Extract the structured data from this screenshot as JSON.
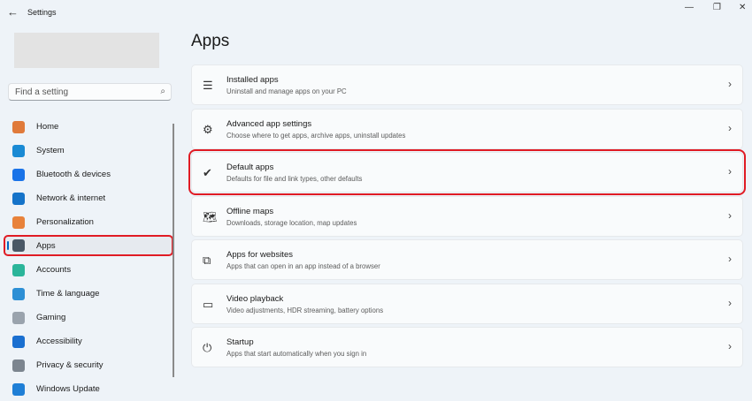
{
  "window": {
    "title": "Settings",
    "back": "←",
    "minimize": "—",
    "maximize": "❐",
    "close": "✕"
  },
  "search": {
    "placeholder": "Find a setting",
    "icon": "⌕"
  },
  "sidebar": {
    "items": [
      {
        "label": "Home",
        "color": "#e07a3a"
      },
      {
        "label": "System",
        "color": "#1a8ad4"
      },
      {
        "label": "Bluetooth & devices",
        "color": "#1a73e8"
      },
      {
        "label": "Network & internet",
        "color": "#1573c9"
      },
      {
        "label": "Personalization",
        "color": "#e8823a"
      },
      {
        "label": "Apps",
        "color": "#4a5866",
        "selected": true
      },
      {
        "label": "Accounts",
        "color": "#2bb59a"
      },
      {
        "label": "Time & language",
        "color": "#2d8fd5"
      },
      {
        "label": "Gaming",
        "color": "#9aa3ad"
      },
      {
        "label": "Accessibility",
        "color": "#1a6fd0"
      },
      {
        "label": "Privacy & security",
        "color": "#7c858f"
      },
      {
        "label": "Windows Update",
        "color": "#1f7fd6"
      }
    ]
  },
  "main": {
    "title": "Apps",
    "cards": [
      {
        "title": "Installed apps",
        "subtitle": "Uninstall and manage apps on your PC",
        "icon": "☰"
      },
      {
        "title": "Advanced app settings",
        "subtitle": "Choose where to get apps, archive apps, uninstall updates",
        "icon": "⚙"
      },
      {
        "title": "Default apps",
        "subtitle": "Defaults for file and link types, other defaults",
        "icon": "✔"
      },
      {
        "title": "Offline maps",
        "subtitle": "Downloads, storage location, map updates",
        "icon": "🗺"
      },
      {
        "title": "Apps for websites",
        "subtitle": "Apps that can open in an app instead of a browser",
        "icon": "⧉"
      },
      {
        "title": "Video playback",
        "subtitle": "Video adjustments, HDR streaming, battery options",
        "icon": "▭"
      },
      {
        "title": "Startup",
        "subtitle": "Apps that start automatically when you sign in",
        "icon": "⏻"
      }
    ],
    "chevron": "›"
  }
}
